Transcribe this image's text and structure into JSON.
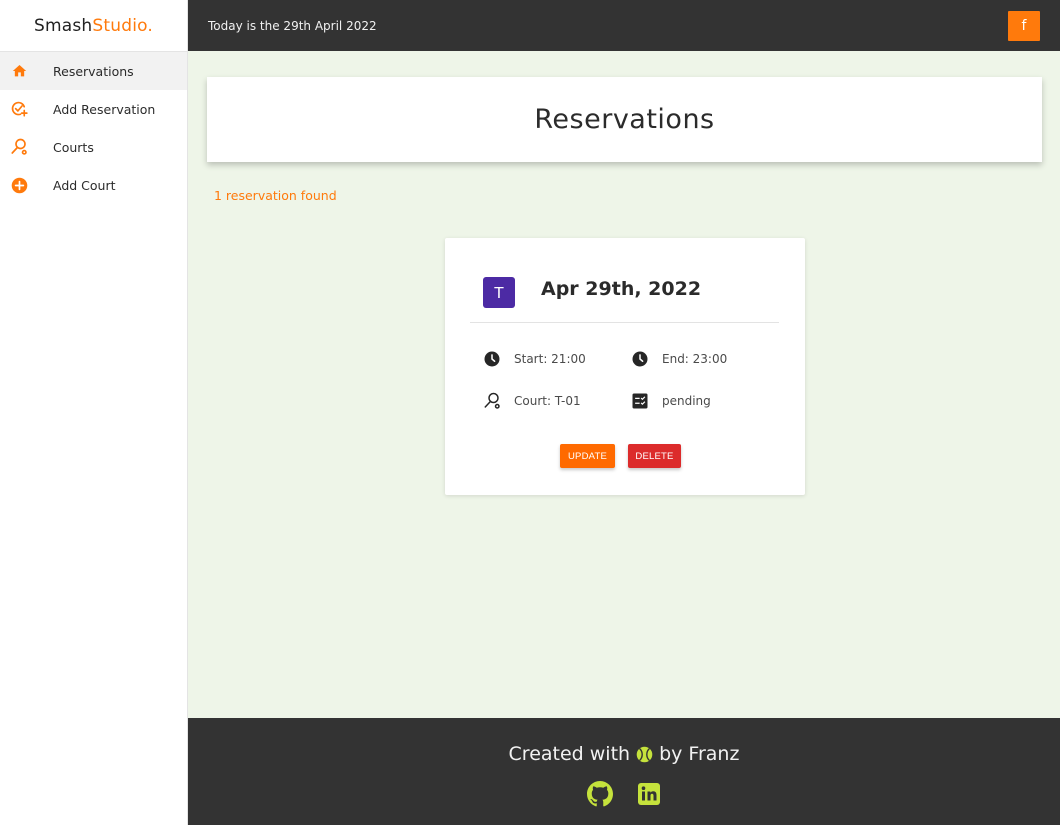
{
  "brand": {
    "part1": "Smash",
    "part2": "Studio."
  },
  "sidebar": {
    "items": [
      {
        "label": "Reservations",
        "icon": "home-icon",
        "active": true
      },
      {
        "label": "Add Reservation",
        "icon": "add-reservation-icon"
      },
      {
        "label": "Courts",
        "icon": "racket-icon"
      },
      {
        "label": "Add Court",
        "icon": "add-circle-icon"
      }
    ]
  },
  "topbar": {
    "date_text": "Today is the 29th April 2022",
    "button_label": "f"
  },
  "page": {
    "title": "Reservations",
    "found_text": "1 reservation found"
  },
  "card": {
    "avatar_letter": "T",
    "date": "Apr 29th, 2022",
    "start": "Start: 21:00",
    "end": "End: 23:00",
    "court": "Court: T-01",
    "status": "pending",
    "update_label": "UPDATE",
    "delete_label": "DELETE"
  },
  "footer": {
    "before": "Created with",
    "after": "by Franz"
  },
  "colors": {
    "accent": "#ff7a0c",
    "update": "#ff6a00",
    "delete": "#dc2b2b",
    "avatar": "#4c2aa4",
    "footer_icons": "#c5e23c",
    "dark": "#333333",
    "background": "#eef5e8"
  }
}
